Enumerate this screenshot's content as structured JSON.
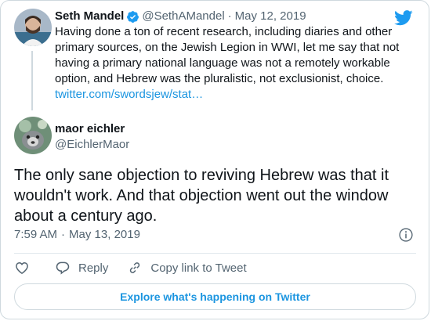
{
  "parent_tweet": {
    "author_name": "Seth Mandel",
    "handle": "@SethAMandel",
    "separator": "·",
    "date": "May 12, 2019",
    "text": "Having done a ton of research, including diaries and other primary sources, on the Jewish Legion in WWI, let me say that not having a primary national language was not a remotely workable option, and Hebrew was the pluralistic, not exclusionist, choice.",
    "text_lines": [
      "Having done a ton of recent research, including diaries and other",
      "primary sources, on the Jewish Legion in WWI, let me say that not",
      "having a primary national language was not a remotely workable",
      "option, and Hebrew was the pluralistic, not exclusionist, choice."
    ],
    "link": "twitter.com/swordsjew/stat…",
    "verified_icon": "verified-badge-icon",
    "twitter_logo": "twitter-bird-icon"
  },
  "main_tweet": {
    "author_name": "maor eichler",
    "handle": "@EichlerMaor",
    "text_lines": [
      "The only sane objection to reviving Hebrew was that it",
      "wouldn't work. And that objection went out the window",
      "about a century ago."
    ],
    "time": "7:59 AM",
    "separator": "·",
    "date": "May 13, 2019"
  },
  "actions": {
    "like_icon": "heart-icon",
    "reply_label": "Reply",
    "copy_label": "Copy link to Tweet"
  },
  "explore_label": "Explore what's happening on Twitter",
  "colors": {
    "link": "#1b95e0",
    "muted": "#536471",
    "text": "#0f1419",
    "border": "#cfd9de"
  }
}
